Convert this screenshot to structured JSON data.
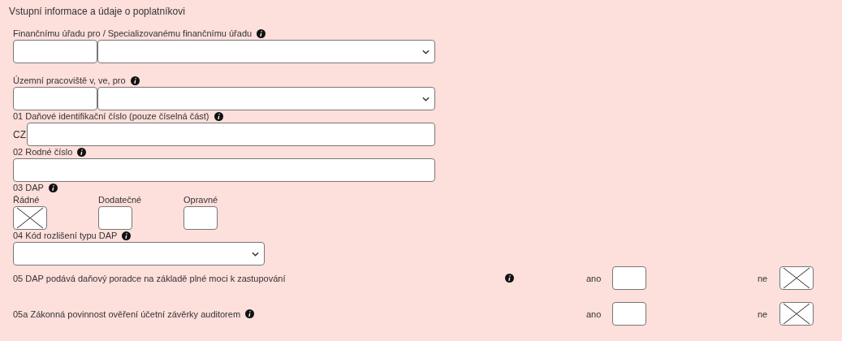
{
  "section_title": "Vstupní informace a údaje o poplatníkovi",
  "office": {
    "label": "Finančnímu úřadu pro / Specializovanému finančnímu úřadu"
  },
  "workplace": {
    "label": "Územní pracoviště v, ve, pro"
  },
  "tax_id": {
    "label": "01 Daňové identifikační číslo (pouze číselná část)",
    "prefix": "CZ"
  },
  "birth_number": {
    "label": "02 Rodné číslo"
  },
  "dap": {
    "label": "03 DAP",
    "options": [
      {
        "label": "Řádné",
        "checked": true
      },
      {
        "label": "Dodatečné",
        "checked": false
      },
      {
        "label": "Opravné",
        "checked": false
      }
    ]
  },
  "dap_type": {
    "label": "04 Kód rozlišení typu DAP"
  },
  "questions": [
    {
      "kind": "detached",
      "label": "05 DAP podává daňový poradce na základě plné moci k zastupování",
      "yes_label": "ano",
      "yes": false,
      "no_label": "ne",
      "no": true
    },
    {
      "kind": "inline",
      "label": "05a Zákonná povinnost ověření účetní závěrky auditorem",
      "yes_label": "ano",
      "yes": false,
      "no_label": "ne",
      "no": true
    }
  ]
}
